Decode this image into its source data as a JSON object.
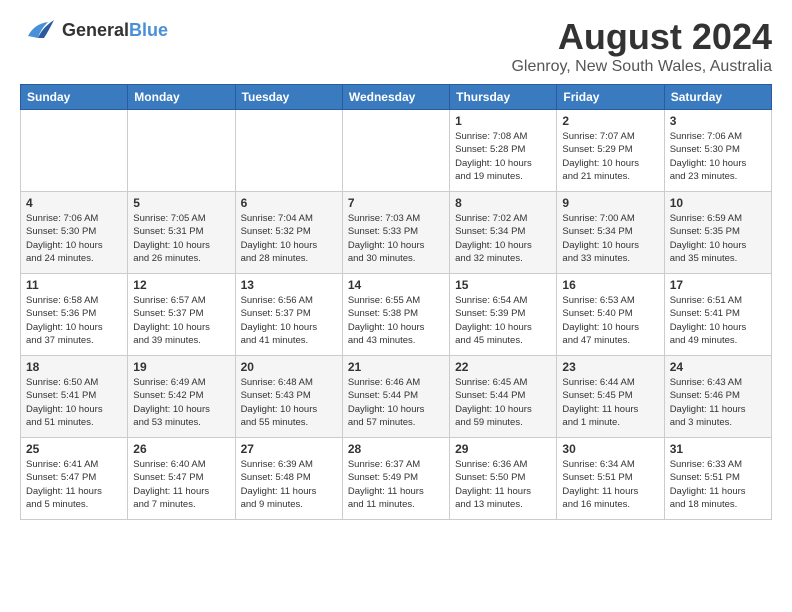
{
  "logo": {
    "general": "General",
    "blue": "Blue"
  },
  "title": {
    "month_year": "August 2024",
    "location": "Glenroy, New South Wales, Australia"
  },
  "headers": [
    "Sunday",
    "Monday",
    "Tuesday",
    "Wednesday",
    "Thursday",
    "Friday",
    "Saturday"
  ],
  "weeks": [
    [
      {
        "day": "",
        "info": ""
      },
      {
        "day": "",
        "info": ""
      },
      {
        "day": "",
        "info": ""
      },
      {
        "day": "",
        "info": ""
      },
      {
        "day": "1",
        "info": "Sunrise: 7:08 AM\nSunset: 5:28 PM\nDaylight: 10 hours\nand 19 minutes."
      },
      {
        "day": "2",
        "info": "Sunrise: 7:07 AM\nSunset: 5:29 PM\nDaylight: 10 hours\nand 21 minutes."
      },
      {
        "day": "3",
        "info": "Sunrise: 7:06 AM\nSunset: 5:30 PM\nDaylight: 10 hours\nand 23 minutes."
      }
    ],
    [
      {
        "day": "4",
        "info": "Sunrise: 7:06 AM\nSunset: 5:30 PM\nDaylight: 10 hours\nand 24 minutes."
      },
      {
        "day": "5",
        "info": "Sunrise: 7:05 AM\nSunset: 5:31 PM\nDaylight: 10 hours\nand 26 minutes."
      },
      {
        "day": "6",
        "info": "Sunrise: 7:04 AM\nSunset: 5:32 PM\nDaylight: 10 hours\nand 28 minutes."
      },
      {
        "day": "7",
        "info": "Sunrise: 7:03 AM\nSunset: 5:33 PM\nDaylight: 10 hours\nand 30 minutes."
      },
      {
        "day": "8",
        "info": "Sunrise: 7:02 AM\nSunset: 5:34 PM\nDaylight: 10 hours\nand 32 minutes."
      },
      {
        "day": "9",
        "info": "Sunrise: 7:00 AM\nSunset: 5:34 PM\nDaylight: 10 hours\nand 33 minutes."
      },
      {
        "day": "10",
        "info": "Sunrise: 6:59 AM\nSunset: 5:35 PM\nDaylight: 10 hours\nand 35 minutes."
      }
    ],
    [
      {
        "day": "11",
        "info": "Sunrise: 6:58 AM\nSunset: 5:36 PM\nDaylight: 10 hours\nand 37 minutes."
      },
      {
        "day": "12",
        "info": "Sunrise: 6:57 AM\nSunset: 5:37 PM\nDaylight: 10 hours\nand 39 minutes."
      },
      {
        "day": "13",
        "info": "Sunrise: 6:56 AM\nSunset: 5:37 PM\nDaylight: 10 hours\nand 41 minutes."
      },
      {
        "day": "14",
        "info": "Sunrise: 6:55 AM\nSunset: 5:38 PM\nDaylight: 10 hours\nand 43 minutes."
      },
      {
        "day": "15",
        "info": "Sunrise: 6:54 AM\nSunset: 5:39 PM\nDaylight: 10 hours\nand 45 minutes."
      },
      {
        "day": "16",
        "info": "Sunrise: 6:53 AM\nSunset: 5:40 PM\nDaylight: 10 hours\nand 47 minutes."
      },
      {
        "day": "17",
        "info": "Sunrise: 6:51 AM\nSunset: 5:41 PM\nDaylight: 10 hours\nand 49 minutes."
      }
    ],
    [
      {
        "day": "18",
        "info": "Sunrise: 6:50 AM\nSunset: 5:41 PM\nDaylight: 10 hours\nand 51 minutes."
      },
      {
        "day": "19",
        "info": "Sunrise: 6:49 AM\nSunset: 5:42 PM\nDaylight: 10 hours\nand 53 minutes."
      },
      {
        "day": "20",
        "info": "Sunrise: 6:48 AM\nSunset: 5:43 PM\nDaylight: 10 hours\nand 55 minutes."
      },
      {
        "day": "21",
        "info": "Sunrise: 6:46 AM\nSunset: 5:44 PM\nDaylight: 10 hours\nand 57 minutes."
      },
      {
        "day": "22",
        "info": "Sunrise: 6:45 AM\nSunset: 5:44 PM\nDaylight: 10 hours\nand 59 minutes."
      },
      {
        "day": "23",
        "info": "Sunrise: 6:44 AM\nSunset: 5:45 PM\nDaylight: 11 hours\nand 1 minute."
      },
      {
        "day": "24",
        "info": "Sunrise: 6:43 AM\nSunset: 5:46 PM\nDaylight: 11 hours\nand 3 minutes."
      }
    ],
    [
      {
        "day": "25",
        "info": "Sunrise: 6:41 AM\nSunset: 5:47 PM\nDaylight: 11 hours\nand 5 minutes."
      },
      {
        "day": "26",
        "info": "Sunrise: 6:40 AM\nSunset: 5:47 PM\nDaylight: 11 hours\nand 7 minutes."
      },
      {
        "day": "27",
        "info": "Sunrise: 6:39 AM\nSunset: 5:48 PM\nDaylight: 11 hours\nand 9 minutes."
      },
      {
        "day": "28",
        "info": "Sunrise: 6:37 AM\nSunset: 5:49 PM\nDaylight: 11 hours\nand 11 minutes."
      },
      {
        "day": "29",
        "info": "Sunrise: 6:36 AM\nSunset: 5:50 PM\nDaylight: 11 hours\nand 13 minutes."
      },
      {
        "day": "30",
        "info": "Sunrise: 6:34 AM\nSunset: 5:51 PM\nDaylight: 11 hours\nand 16 minutes."
      },
      {
        "day": "31",
        "info": "Sunrise: 6:33 AM\nSunset: 5:51 PM\nDaylight: 11 hours\nand 18 minutes."
      }
    ]
  ]
}
